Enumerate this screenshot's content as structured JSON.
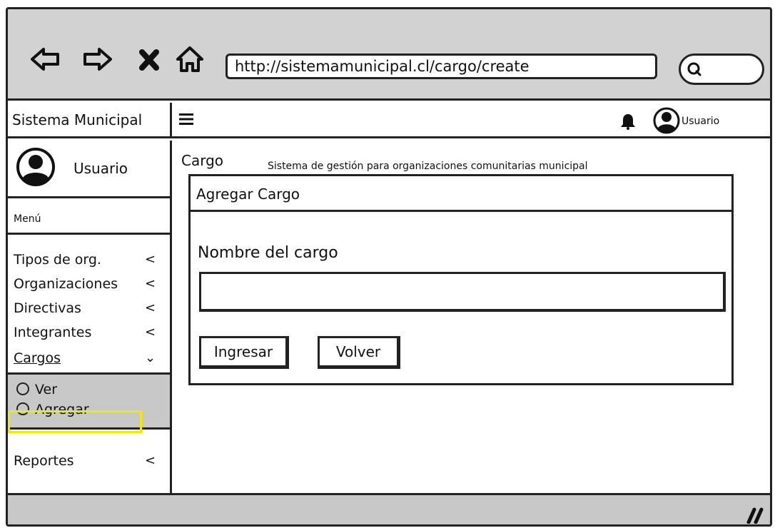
{
  "browser": {
    "url": "http://sistemamunicipal.cl/cargo/create",
    "search_placeholder": ""
  },
  "header": {
    "brand": "Sistema Municipal",
    "user_label": "Usuario"
  },
  "sidebar": {
    "user_name": "Usuario",
    "menu_header": "Menú",
    "items": [
      {
        "label": "Tipos de org.",
        "chevron": "<"
      },
      {
        "label": "Organizaciones",
        "chevron": "<"
      },
      {
        "label": "Directivas",
        "chevron": "<"
      },
      {
        "label": "Integrantes",
        "chevron": "<"
      },
      {
        "label": "Cargos",
        "chevron": "⌄"
      }
    ],
    "subitems": [
      {
        "label": "Ver"
      },
      {
        "label": "Agregar"
      }
    ],
    "reports": {
      "label": "Reportes",
      "chevron": "<"
    },
    "highlight_color": "#f2ea00"
  },
  "main": {
    "title": "Cargo",
    "subtitle": "Sistema de gestión para organizaciones comunitarias municipal",
    "card": {
      "header": "Agregar Cargo",
      "field_label": "Nombre del cargo",
      "field_value": "",
      "submit_label": "Ingresar",
      "back_label": "Volver"
    }
  },
  "colors": {
    "chrome": "#d2d2d2",
    "submenu": "#c8c8c8",
    "stroke": "#222222"
  }
}
